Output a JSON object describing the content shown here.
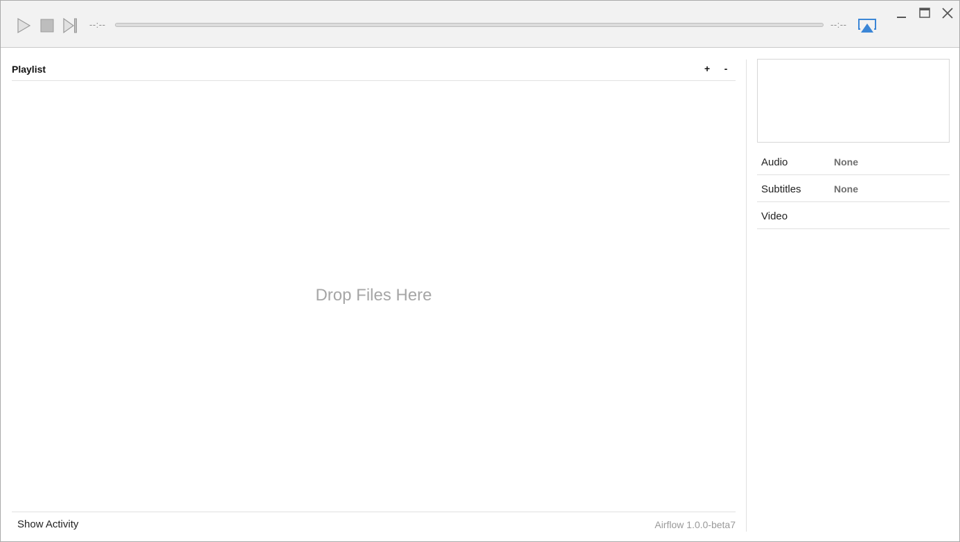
{
  "player": {
    "time_elapsed": "--:--",
    "time_remaining": "--:--",
    "progress": 0
  },
  "icons": {
    "play": "play-icon",
    "stop": "stop-icon",
    "next": "skip-next-icon",
    "cast": "airplay-icon",
    "minimize": "minimize-icon",
    "maximize": "maximize-icon",
    "close": "close-icon"
  },
  "colors": {
    "toolbar_bg": "#f2f2f2",
    "cast_accent": "#3b86d6",
    "muted_text": "#a6a6a6"
  },
  "playlist": {
    "title": "Playlist",
    "add_label": "+",
    "remove_label": "-",
    "drop_text": "Drop Files Here"
  },
  "footer": {
    "show_activity": "Show Activity",
    "version": "Airflow 1.0.0-beta7"
  },
  "tracks": {
    "audio": {
      "label": "Audio",
      "value": "None"
    },
    "subtitles": {
      "label": "Subtitles",
      "value": "None"
    },
    "video": {
      "label": "Video",
      "value": ""
    }
  }
}
